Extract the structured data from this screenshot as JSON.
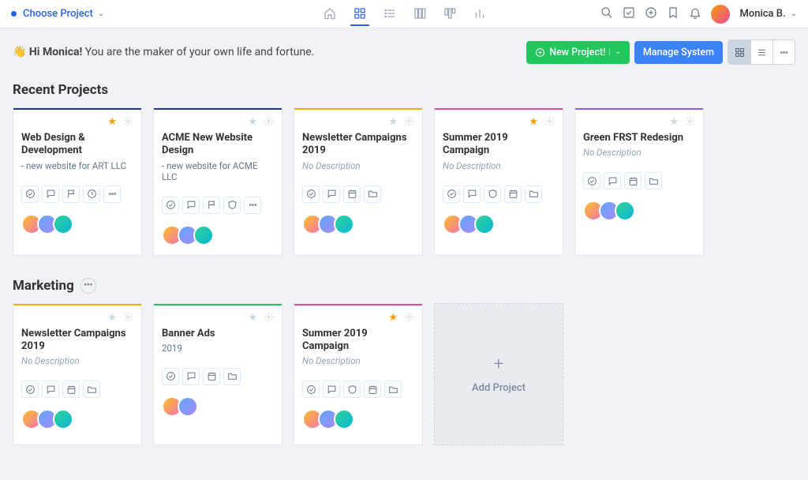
{
  "header": {
    "project_selector": "Choose Project",
    "user_name": "Monica B."
  },
  "greeting": {
    "prefix": "👋 ",
    "bold": "Hi Monica!",
    "rest": " You are the maker of your own life and fortune."
  },
  "action_bar": {
    "new_project": "New Project!",
    "manage_system": "Manage System"
  },
  "sections": [
    {
      "title": "Recent Projects",
      "has_more_btn": false,
      "cards": [
        {
          "color": "#1e3a8a",
          "starred": true,
          "title": "Web Design & Development",
          "desc": "- new website for ART LLC",
          "desc_plain": true,
          "tools": [
            "check",
            "comment",
            "flag",
            "clock",
            "dots"
          ],
          "avatars": 3
        },
        {
          "color": "#1e3a8a",
          "starred": false,
          "title": "ACME New Website Design",
          "desc": "- new website for ACME LLC",
          "desc_plain": true,
          "tools": [
            "check",
            "comment",
            "flag",
            "shield",
            "dots"
          ],
          "avatars": 3
        },
        {
          "color": "#eab308",
          "starred": false,
          "title": "Newsletter Campaigns 2019",
          "desc": "No Description",
          "desc_plain": false,
          "tools": [
            "check",
            "comment",
            "cal",
            "folder"
          ],
          "avatars": 3
        },
        {
          "color": "#ec4899",
          "starred": true,
          "title": "Summer 2019 Campaign",
          "desc": "No Description",
          "desc_plain": false,
          "tools": [
            "check",
            "comment",
            "shield",
            "cal",
            "folder"
          ],
          "avatars": 3
        },
        {
          "color": "#8b5cf6",
          "starred": false,
          "title": "Green FRST Redesign",
          "desc": "No Description",
          "desc_plain": false,
          "tools": [
            "check",
            "comment",
            "cal",
            "folder"
          ],
          "avatars": 3
        }
      ]
    },
    {
      "title": "Marketing",
      "has_more_btn": true,
      "cards": [
        {
          "color": "#eab308",
          "starred": false,
          "title": "Newsletter Campaigns 2019",
          "desc": "No Description",
          "desc_plain": false,
          "tools": [
            "check",
            "comment",
            "cal",
            "folder"
          ],
          "avatars": 3
        },
        {
          "color": "#22c55e",
          "starred": false,
          "title": "Banner Ads",
          "desc": "2019",
          "desc_plain": true,
          "tools": [
            "check",
            "comment",
            "cal",
            "folder"
          ],
          "avatars": 2
        },
        {
          "color": "#ec4899",
          "starred": true,
          "title": "Summer 2019 Campaign",
          "desc": "No Description",
          "desc_plain": false,
          "tools": [
            "check",
            "comment",
            "shield",
            "cal",
            "folder"
          ],
          "avatars": 3
        }
      ],
      "add_card": "Add Project"
    }
  ],
  "icons": {
    "home": "home-icon",
    "grid": "grid-icon",
    "list": "list-icon",
    "board": "board-icon",
    "kanban": "kanban-icon",
    "chart": "chart-icon",
    "search": "search-icon",
    "approve": "approve-icon",
    "add": "add-circle-icon",
    "bookmark": "bookmark-icon",
    "bell": "bell-icon"
  }
}
